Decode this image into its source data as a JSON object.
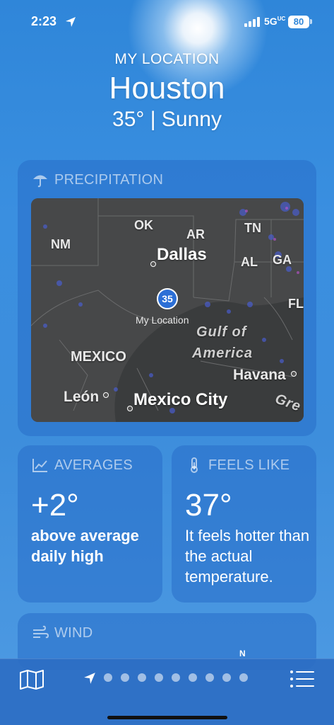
{
  "status": {
    "time": "2:23",
    "network": "5G",
    "network_suffix": "UC",
    "battery": "80"
  },
  "header": {
    "location_label": "MY LOCATION",
    "city": "Houston",
    "conditions": "35° | Sunny"
  },
  "precipitation": {
    "title": "PRECIPITATION",
    "map": {
      "pin_value": "35",
      "pin_label": "My Location",
      "labels": {
        "ok": "OK",
        "nm": "NM",
        "ar": "AR",
        "tn": "TN",
        "al": "AL",
        "ga": "GA",
        "fl": "FL",
        "dallas": "Dallas",
        "mexico": "MEXICO",
        "leon": "León",
        "mexico_city": "Mexico City",
        "havana": "Havana",
        "gulf_line1": "Gulf of",
        "gulf_line2": "America",
        "gre": "Gre"
      }
    }
  },
  "averages": {
    "title": "AVERAGES",
    "value": "+2°",
    "description": "above average daily high"
  },
  "feels_like": {
    "title": "FEELS LIKE",
    "value": "37°",
    "description": "It feels hotter than the actual temperature."
  },
  "wind": {
    "title": "WIND",
    "compass_n": "N"
  },
  "tabbar": {
    "page_count": 9,
    "current_page": 0
  },
  "colors": {
    "background": "#2f86d9",
    "card": "#2d6ec8",
    "map_land": "#454748",
    "pin": "#2c6fd6"
  }
}
